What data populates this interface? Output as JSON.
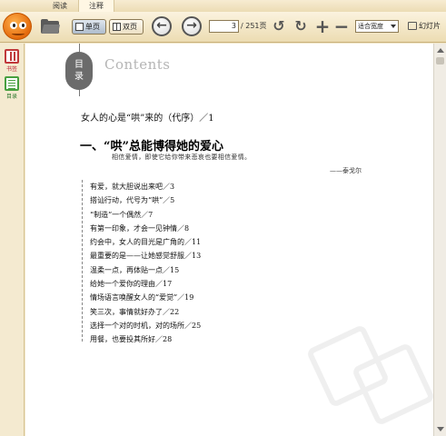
{
  "menu": {
    "tabs": [
      "阅读",
      "注释"
    ]
  },
  "toolbar": {
    "single_page_label": "单页",
    "double_page_label": "双页",
    "current_page": "3",
    "total_pages": "/ 251页",
    "zoom_option": "适合宽度",
    "slideshow_label": "幻灯片",
    "icons": [
      "app-logo",
      "open-folder",
      "prev-page",
      "next-page",
      "rotate-left",
      "rotate-right",
      "zoom-in",
      "zoom-out"
    ]
  },
  "sidebar": {
    "shelf_label": "书签",
    "toc_label": "目录"
  },
  "document": {
    "heading_cn_1": "目",
    "heading_cn_2": "录",
    "heading_en": "Contents",
    "preface": "女人的心是“哄”来的（代序）／1",
    "chapter_title": "一、“哄”总能博得她的爱心",
    "quote": "相信爱情，即使它给你带来悲哀也要相信爱情。",
    "quote_author": "——泰戈尔",
    "entries": [
      "有爱，就大胆说出来吧／3",
      "搭讪行动，代号为“哄”／5",
      "“制造”一个偶然／7",
      "有第一印象，才会一见钟情／8",
      "约会中，女人的目光是广角的／11",
      "最重要的是——让她感觉舒服／13",
      "温柔一点，再体贴一点／15",
      "给她一个爱你的理由／17",
      "情场语言唤醒女人的“爱觉”／19",
      "笑三次，事情就好办了／22",
      "选择一个对的时机，对的场所／25",
      "用餐，也要投其所好／28"
    ]
  }
}
